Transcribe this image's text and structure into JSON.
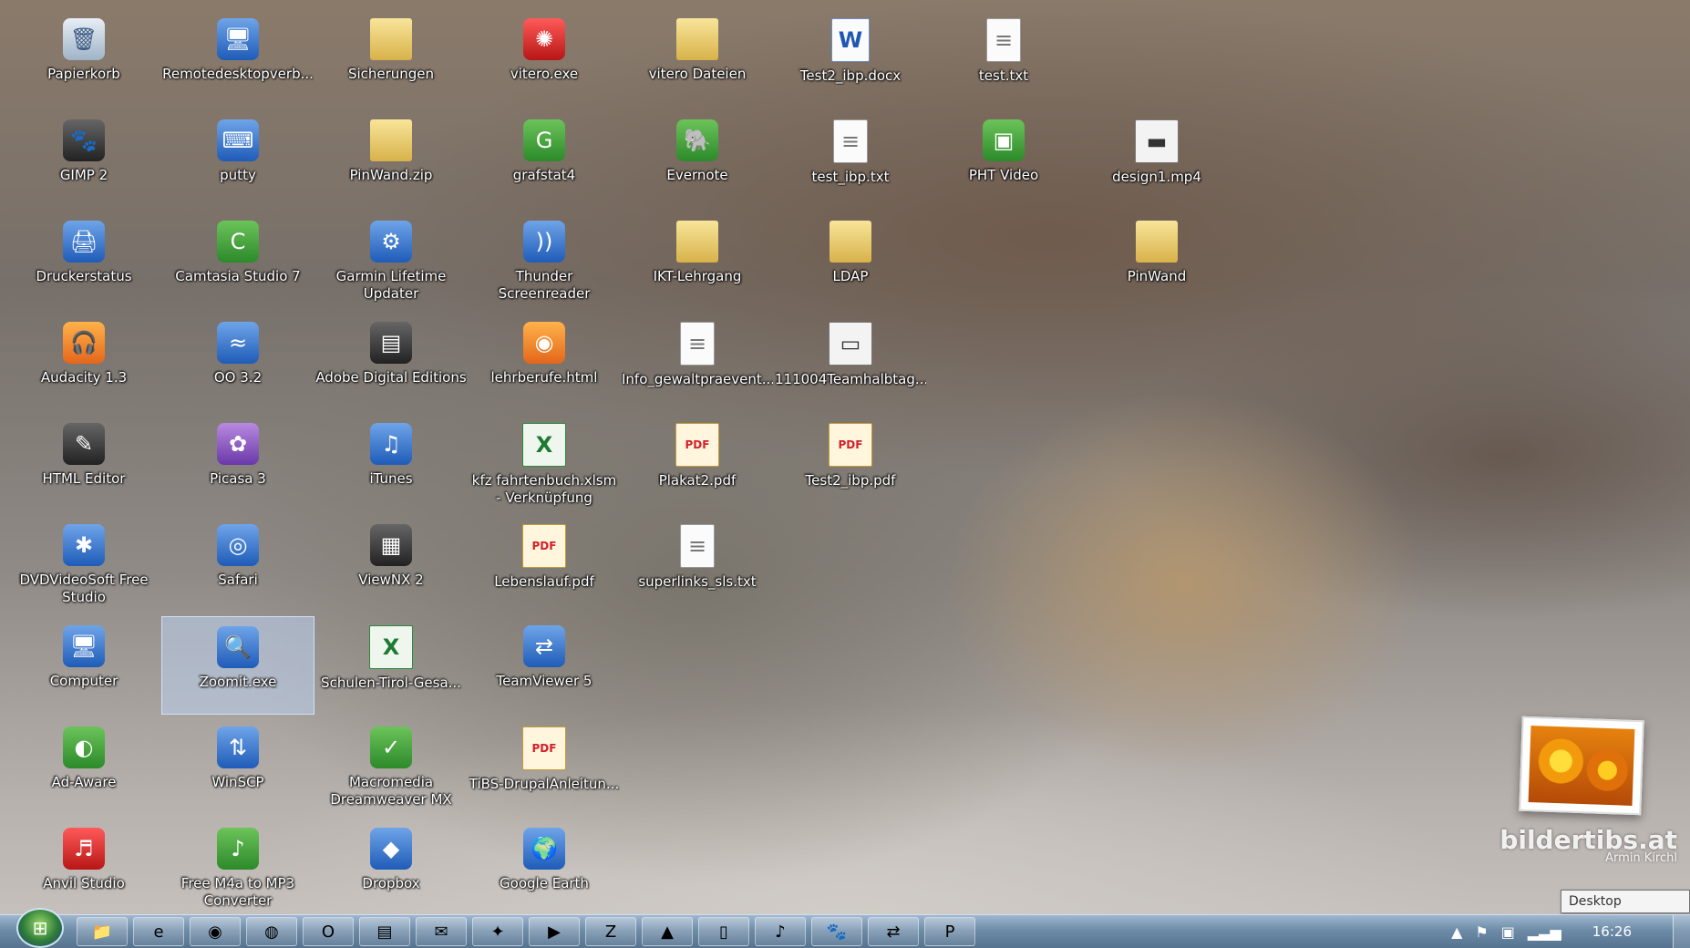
{
  "desktop": {
    "icons": [
      {
        "label": "Papierkorb",
        "icon": "recycle-bin-icon",
        "glyph": "🗑",
        "type": "g-recycle"
      },
      {
        "label": "Remotedesktopverb...",
        "icon": "remote-desktop-icon",
        "glyph": "🖥",
        "type": "g-app"
      },
      {
        "label": "Sicherungen",
        "icon": "folder-icon",
        "glyph": "",
        "type": "g-folder"
      },
      {
        "label": "vitero.exe",
        "icon": "vitero-icon",
        "glyph": "✺",
        "type": "g-red"
      },
      {
        "label": "vitero Dateien",
        "icon": "folder-icon",
        "glyph": "",
        "type": "g-folder"
      },
      {
        "label": "Test2_ibp.docx",
        "icon": "word-document-icon",
        "glyph": "W",
        "type": "g-word"
      },
      {
        "label": "test.txt",
        "icon": "text-file-icon",
        "glyph": "≡",
        "type": "g-doc"
      },
      {
        "label": "GIMP 2",
        "icon": "gimp-icon",
        "glyph": "🐾",
        "type": "g-dark"
      },
      {
        "label": "putty",
        "icon": "putty-icon",
        "glyph": "⌨",
        "type": "g-app"
      },
      {
        "label": "PinWand.zip",
        "icon": "zip-folder-icon",
        "glyph": "",
        "type": "g-folder"
      },
      {
        "label": "grafstat4",
        "icon": "grafstat-icon",
        "glyph": "G",
        "type": "g-green"
      },
      {
        "label": "Evernote",
        "icon": "evernote-icon",
        "glyph": "🐘",
        "type": "g-green"
      },
      {
        "label": "test_ibp.txt",
        "icon": "text-file-icon",
        "glyph": "≡",
        "type": "g-doc"
      },
      {
        "label": "PHT Video",
        "icon": "pht-video-icon",
        "glyph": "▣",
        "type": "g-green"
      },
      {
        "label": "design1.mp4",
        "icon": "video-file-icon",
        "glyph": "▬",
        "type": "g-video"
      },
      {
        "label": "Druckerstatus",
        "icon": "printer-icon",
        "glyph": "🖨",
        "type": "g-app"
      },
      {
        "label": "Camtasia Studio 7",
        "icon": "camtasia-icon",
        "glyph": "C",
        "type": "g-green"
      },
      {
        "label": "Garmin Lifetime Updater",
        "icon": "garmin-icon",
        "glyph": "⚙",
        "type": "g-app"
      },
      {
        "label": "Thunder Screenreader",
        "icon": "thunder-screenreader-icon",
        "glyph": "))",
        "type": "g-app"
      },
      {
        "label": "IKT-Lehrgang",
        "icon": "folder-icon",
        "glyph": "",
        "type": "g-folder"
      },
      {
        "label": "LDAP",
        "icon": "folder-icon",
        "glyph": "",
        "type": "g-folder"
      },
      {
        "label": "PinWand",
        "icon": "folder-icon",
        "glyph": "",
        "type": "g-folder"
      },
      {
        "label": "Audacity 1.3",
        "icon": "audacity-icon",
        "glyph": "🎧",
        "type": "g-orange"
      },
      {
        "label": "OO 3.2",
        "icon": "openoffice-icon",
        "glyph": "≈",
        "type": "g-app"
      },
      {
        "label": "Adobe Digital Editions",
        "icon": "adobe-digital-editions-icon",
        "glyph": "▤",
        "type": "g-dark"
      },
      {
        "label": "lehrberufe.html",
        "icon": "firefox-document-icon",
        "glyph": "◉",
        "type": "g-orange"
      },
      {
        "label": "Info_gewaltpraevent...",
        "icon": "text-file-icon",
        "glyph": "≡",
        "type": "g-doc"
      },
      {
        "label": "111004Teamhalbtag...",
        "icon": "image-file-icon",
        "glyph": "▭",
        "type": "g-video"
      },
      {
        "label": "HTML Editor",
        "icon": "html-editor-icon",
        "glyph": "✎",
        "type": "g-dark"
      },
      {
        "label": "Picasa 3",
        "icon": "picasa-icon",
        "glyph": "✿",
        "type": "g-purple"
      },
      {
        "label": "iTunes",
        "icon": "itunes-icon",
        "glyph": "♫",
        "type": "g-app"
      },
      {
        "label": "kfz fahrtenbuch.xlsm - Verknüpfung",
        "icon": "excel-shortcut-icon",
        "glyph": "X",
        "type": "g-excel"
      },
      {
        "label": "Plakat2.pdf",
        "icon": "pdf-icon",
        "glyph": "PDF",
        "type": "g-pdf"
      },
      {
        "label": "Test2_ibp.pdf",
        "icon": "pdf-icon",
        "glyph": "PDF",
        "type": "g-pdf"
      },
      {
        "label": "DVDVideoSoft Free Studio",
        "icon": "dvdvideosoft-icon",
        "glyph": "✱",
        "type": "g-app"
      },
      {
        "label": "Safari",
        "icon": "safari-icon",
        "glyph": "◎",
        "type": "g-app"
      },
      {
        "label": "ViewNX 2",
        "icon": "viewnx-icon",
        "glyph": "▦",
        "type": "g-dark"
      },
      {
        "label": "Lebenslauf.pdf",
        "icon": "pdf-icon",
        "glyph": "PDF",
        "type": "g-pdf"
      },
      {
        "label": "superlinks_sls.txt",
        "icon": "text-file-icon",
        "glyph": "≡",
        "type": "g-doc"
      },
      {
        "label": "Computer",
        "icon": "computer-icon",
        "glyph": "🖥",
        "type": "g-app"
      },
      {
        "label": "Zoomit.exe",
        "icon": "zoomit-icon",
        "glyph": "🔍",
        "type": "g-app",
        "selected": true
      },
      {
        "label": "Schulen-Tirol-Gesa...",
        "icon": "excel-file-icon",
        "glyph": "X",
        "type": "g-excel"
      },
      {
        "label": "TeamViewer 5",
        "icon": "teamviewer-icon",
        "glyph": "⇄",
        "type": "g-app"
      },
      {
        "label": "Ad-Aware",
        "icon": "ad-aware-icon",
        "glyph": "◐",
        "type": "g-green"
      },
      {
        "label": "WinSCP",
        "icon": "winscp-icon",
        "glyph": "⇅",
        "type": "g-app"
      },
      {
        "label": "Macromedia Dreamweaver MX",
        "icon": "dreamweaver-icon",
        "glyph": "✓",
        "type": "g-green"
      },
      {
        "label": "TiBS-DrupalAnleitun...",
        "icon": "pdf-icon",
        "glyph": "PDF",
        "type": "g-pdf"
      },
      {
        "label": "Anvil Studio",
        "icon": "anvil-studio-icon",
        "glyph": "♬",
        "type": "g-red"
      },
      {
        "label": "Free M4a to MP3 Converter",
        "icon": "m4a-converter-icon",
        "glyph": "♪",
        "type": "g-green"
      },
      {
        "label": "Dropbox",
        "icon": "dropbox-icon",
        "glyph": "◆",
        "type": "g-app"
      },
      {
        "label": "Google Earth",
        "icon": "google-earth-icon",
        "glyph": "🌍",
        "type": "g-app"
      }
    ]
  },
  "watermark": {
    "title": "bildertibs.at",
    "author": "Armin Kirchl"
  },
  "tooltip": {
    "text": "Desktop anzeigen"
  },
  "taskbar": {
    "tasks": [
      {
        "name": "explorer-icon",
        "glyph": "📁"
      },
      {
        "name": "internet-explorer-icon",
        "glyph": "e"
      },
      {
        "name": "firefox-icon",
        "glyph": "◉"
      },
      {
        "name": "chrome-icon",
        "glyph": "◍"
      },
      {
        "name": "opera-icon",
        "glyph": "O"
      },
      {
        "name": "notepad-icon",
        "glyph": "▤"
      },
      {
        "name": "thunderbird-icon",
        "glyph": "✉"
      },
      {
        "name": "paint-icon",
        "glyph": "✦"
      },
      {
        "name": "media-player-icon",
        "glyph": "▶"
      },
      {
        "name": "filezilla-icon",
        "glyph": "Z"
      },
      {
        "name": "vlc-icon",
        "glyph": "▲"
      },
      {
        "name": "document-icon",
        "glyph": "▯"
      },
      {
        "name": "music-icon",
        "glyph": "♪"
      },
      {
        "name": "gimp-taskbar-icon",
        "glyph": "🐾"
      },
      {
        "name": "network-icon",
        "glyph": "⇄"
      },
      {
        "name": "powerpoint-icon",
        "glyph": "P"
      }
    ],
    "tray": {
      "arrow": "▲",
      "flag": "⚑",
      "network": "▣",
      "signal": "▂▃▅",
      "clock": "16:26"
    }
  }
}
